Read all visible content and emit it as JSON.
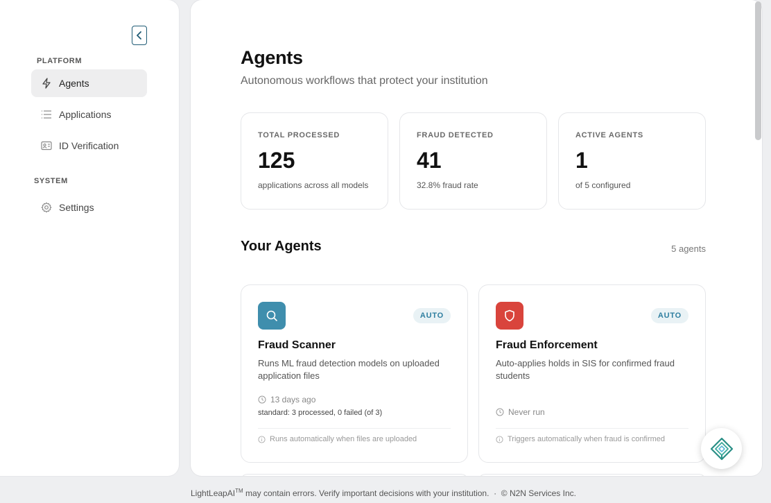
{
  "sidebar": {
    "sections": {
      "platform": "PLATFORM",
      "system": "SYSTEM"
    },
    "items": {
      "agents": "Agents",
      "applications": "Applications",
      "id_verification": "ID Verification",
      "settings": "Settings"
    },
    "active": "agents"
  },
  "main": {
    "title": "Agents",
    "subtitle": "Autonomous workflows that protect your institution",
    "stats": [
      {
        "label": "TOTAL PROCESSED",
        "value": "125",
        "sub": "applications across all models"
      },
      {
        "label": "FRAUD DETECTED",
        "value": "41",
        "sub": "32.8% fraud rate"
      },
      {
        "label": "ACTIVE AGENTS",
        "value": "1",
        "sub": "of 5 configured"
      }
    ],
    "agents_section": {
      "title": "Your Agents",
      "count": "5 agents"
    },
    "agents": [
      {
        "name": "Fraud Scanner",
        "badge": "AUTO",
        "icon": "search-icon",
        "icon_color": "#3f8ead",
        "description": "Runs ML fraud detection models on uploaded application files",
        "last_run": "13 days ago",
        "stats": "standard: 3 processed, 0 failed (of 3)",
        "trigger": "Runs automatically when files are uploaded"
      },
      {
        "name": "Fraud Enforcement",
        "badge": "AUTO",
        "icon": "shield-icon",
        "icon_color": "#d9443c",
        "description": "Auto-applies holds in SIS for confirmed fraud students",
        "last_run": "Never run",
        "stats": "",
        "trigger": "Triggers automatically when fraud is confirmed"
      }
    ]
  },
  "footer": {
    "brand": "LightLeapAI",
    "trademark": "TM",
    "text": " may contain errors. Verify important decisions with your institution.  ·  © N2N Services Inc."
  },
  "colors": {
    "accent": "#1f5b75",
    "badge_text": "#2f7fa0",
    "badge_bg": "#e9f2f5"
  }
}
